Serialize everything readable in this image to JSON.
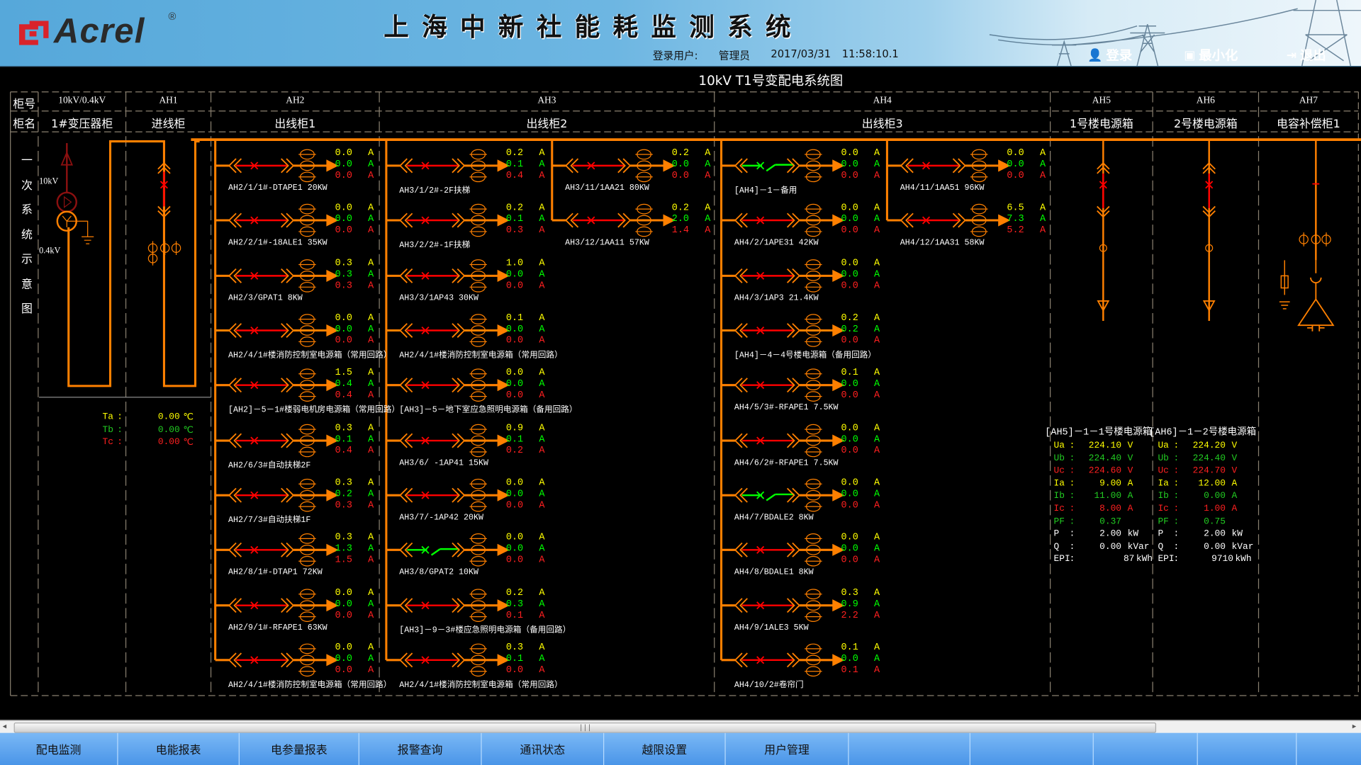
{
  "header": {
    "logo_text": "Acrel",
    "logo_reg": "®",
    "title": "上海中新社能耗监测系统",
    "user_label": "登录用户:",
    "user_name": "管理员",
    "date": "2017/03/31",
    "time": "11:58:10.1",
    "buttons": [
      {
        "label": "登录",
        "icon": "user-icon"
      },
      {
        "label": "最小化",
        "icon": "minimize-icon"
      },
      {
        "label": "退出",
        "icon": "exit-icon"
      }
    ],
    "colors": {
      "brand_red": "#d8232a",
      "header_blue": "#56a8da"
    }
  },
  "diagram": {
    "title": "10kV T1号变配电系统图",
    "row_header_no": "柜号",
    "row_header_name": "柜名",
    "side_title": [
      "一",
      "次",
      "系",
      "统",
      "示",
      "意",
      "图"
    ],
    "cabinets": [
      {
        "no": "10kV/0.4kV",
        "name": "1#变压器柜"
      },
      {
        "no": "AH1",
        "name": "进线柜"
      },
      {
        "no": "AH2",
        "name": "出线柜1"
      },
      {
        "no": "AH3",
        "name": "出线柜2"
      },
      {
        "no": "AH4",
        "name": "出线柜3"
      },
      {
        "no": "AH5",
        "name": "1号楼电源箱"
      },
      {
        "no": "AH6",
        "name": "2号楼电源箱"
      },
      {
        "no": "AH7",
        "name": "电容补偿柜1"
      }
    ],
    "transformer": {
      "hv": "10kV",
      "lv": "0.4kV"
    },
    "temperatures": [
      {
        "label": "Ta",
        "value": "0.00",
        "unit": "℃"
      },
      {
        "label": "Tb",
        "value": "0.00",
        "unit": "℃"
      },
      {
        "label": "Tc",
        "value": "0.00",
        "unit": "℃"
      }
    ],
    "unit": "A",
    "colors": {
      "bus": "#ff8000",
      "phase_a": "#ffff00",
      "phase_b": "#00ff00",
      "phase_c": "#ff0000",
      "breaker_closed": "#ff0000",
      "breaker_open": "#00ff00"
    },
    "ah2": [
      {
        "label": "AH2/1/1#-DTAPE1 20KW",
        "values": [
          "0.0",
          "0.0",
          "0.0"
        ],
        "state": "closed"
      },
      {
        "label": "AH2/2/1#-18ALE1 35KW",
        "values": [
          "0.0",
          "0.0",
          "0.0"
        ],
        "state": "closed"
      },
      {
        "label": "AH2/3/GPAT1 8KW",
        "values": [
          "0.3",
          "0.3",
          "0.3"
        ],
        "state": "closed"
      },
      {
        "label": "AH2/4/1#楼消防控制室电源箱（常用回路）",
        "values": [
          "0.0",
          "0.0",
          "0.0"
        ],
        "state": "closed"
      },
      {
        "label": "[AH2]－5－1#楼弱电机房电源箱（常用回路）",
        "values": [
          "1.5",
          "0.4",
          "0.4"
        ],
        "state": "closed"
      },
      {
        "label": "AH2/6/3#自动扶梯2F",
        "values": [
          "0.3",
          "0.1",
          "0.4"
        ],
        "state": "closed"
      },
      {
        "label": "AH2/7/3#自动扶梯1F",
        "values": [
          "0.3",
          "0.2",
          "0.3"
        ],
        "state": "closed"
      },
      {
        "label": "AH2/8/1#-DTAP1 72KW",
        "values": [
          "0.3",
          "1.3",
          "1.5"
        ],
        "state": "closed"
      },
      {
        "label": "AH2/9/1#-RFAPE1 63KW",
        "values": [
          "0.0",
          "0.0",
          "0.0"
        ],
        "state": "closed"
      },
      {
        "label": "AH2/4/1#楼消防控制室电源箱（常用回路）",
        "values": [
          "0.0",
          "0.0",
          "0.0"
        ],
        "state": "closed"
      }
    ],
    "ah3": [
      {
        "label": "AH3/1/2#-2F扶梯",
        "values": [
          "0.2",
          "0.1",
          "0.4"
        ],
        "state": "closed"
      },
      {
        "label": "AH3/2/2#-1F扶梯",
        "values": [
          "0.2",
          "0.1",
          "0.3"
        ],
        "state": "closed"
      },
      {
        "label": "AH3/3/1AP43 30KW",
        "values": [
          "1.0",
          "0.0",
          "0.0"
        ],
        "state": "closed"
      },
      {
        "label": "AH2/4/1#楼消防控制室电源箱（常用回路）",
        "values": [
          "0.1",
          "0.0",
          "0.0"
        ],
        "state": "closed"
      },
      {
        "label": "[AH3]－5－地下室应急照明电源箱（备用回路）",
        "values": [
          "0.0",
          "0.0",
          "0.0"
        ],
        "state": "closed"
      },
      {
        "label": "AH3/6/ -1AP41 15KW",
        "values": [
          "0.9",
          "0.1",
          "0.2"
        ],
        "state": "closed"
      },
      {
        "label": "AH3/7/-1AP42 20KW",
        "values": [
          "0.0",
          "0.0",
          "0.0"
        ],
        "state": "closed"
      },
      {
        "label": "AH3/8/GPAT2 10KW",
        "values": [
          "0.0",
          "0.0",
          "0.0"
        ],
        "state": "open"
      },
      {
        "label": "[AH3]－9－3#楼应急照明电源箱（备用回路）",
        "values": [
          "0.2",
          "0.3",
          "0.1"
        ],
        "state": "closed"
      },
      {
        "label": "AH2/4/1#楼消防控制室电源箱（常用回路）",
        "values": [
          "0.3",
          "0.1",
          "0.0"
        ],
        "state": "closed"
      }
    ],
    "ah3_sub": [
      {
        "label": "AH3/11/1AA21 80KW",
        "values": [
          "0.2",
          "0.0",
          "0.0"
        ],
        "state": "closed"
      },
      {
        "label": "AH3/12/1AA11 57KW",
        "values": [
          "0.2",
          "2.0",
          "1.4"
        ],
        "state": "closed"
      }
    ],
    "ah4": [
      {
        "label": "[AH4]－1－备用",
        "values": [
          "0.0",
          "0.0",
          "0.0"
        ],
        "state": "open"
      },
      {
        "label": "AH4/2/1APE31 42KW",
        "values": [
          "0.0",
          "0.0",
          "0.0"
        ],
        "state": "closed"
      },
      {
        "label": "AH4/3/1AP3 21.4KW",
        "values": [
          "0.0",
          "0.0",
          "0.0"
        ],
        "state": "closed"
      },
      {
        "label": "[AH4]－4－4号楼电源箱（备用回路）",
        "values": [
          "0.2",
          "0.2",
          "0.0"
        ],
        "state": "closed"
      },
      {
        "label": "AH4/5/3#-RFAPE1 7.5KW",
        "values": [
          "0.1",
          "0.0",
          "0.0"
        ],
        "state": "closed"
      },
      {
        "label": "AH4/6/2#-RFAPE1 7.5KW",
        "values": [
          "0.0",
          "0.0",
          "0.0"
        ],
        "state": "closed"
      },
      {
        "label": "AH4/7/BDALE2 8KW",
        "values": [
          "0.0",
          "0.0",
          "0.0"
        ],
        "state": "open"
      },
      {
        "label": "AH4/8/BDALE1 8KW",
        "values": [
          "0.0",
          "0.0",
          "0.0"
        ],
        "state": "closed"
      },
      {
        "label": "AH4/9/1ALE3 5KW",
        "values": [
          "0.3",
          "0.9",
          "2.2"
        ],
        "state": "closed"
      },
      {
        "label": "AH4/10/2#卷帘门",
        "values": [
          "0.1",
          "0.0",
          "0.1"
        ],
        "state": "closed"
      }
    ],
    "ah4_sub": [
      {
        "label": "AH4/11/1AA51 96KW",
        "values": [
          "0.0",
          "0.0",
          "0.0"
        ],
        "state": "closed"
      },
      {
        "label": "AH4/12/1AA31 58KW",
        "values": [
          "6.5",
          "7.3",
          "5.2"
        ],
        "state": "closed"
      }
    ],
    "meters": [
      {
        "title": "[AH5]－1－1号楼电源箱",
        "rows": [
          {
            "label": "Ua",
            "value": "224.10",
            "unit": "V"
          },
          {
            "label": "Ub",
            "value": "224.40",
            "unit": "V"
          },
          {
            "label": "Uc",
            "value": "224.60",
            "unit": "V"
          },
          {
            "label": "Ia",
            "value": "9.00",
            "unit": "A"
          },
          {
            "label": "Ib",
            "value": "11.00",
            "unit": "A"
          },
          {
            "label": "Ic",
            "value": "8.00",
            "unit": "A"
          },
          {
            "label": "PF",
            "value": "0.37",
            "unit": ""
          },
          {
            "label": "P",
            "value": "2.00",
            "unit": "kW"
          },
          {
            "label": "Q",
            "value": "0.00",
            "unit": "kVar"
          },
          {
            "label": "EPI",
            "value": "87",
            "unit": "kWh"
          }
        ]
      },
      {
        "title": "[AH6]－1－2号楼电源箱",
        "rows": [
          {
            "label": "Ua",
            "value": "224.20",
            "unit": "V"
          },
          {
            "label": "Ub",
            "value": "224.40",
            "unit": "V"
          },
          {
            "label": "Uc",
            "value": "224.70",
            "unit": "V"
          },
          {
            "label": "Ia",
            "value": "12.00",
            "unit": "A"
          },
          {
            "label": "Ib",
            "value": "0.00",
            "unit": "A"
          },
          {
            "label": "Ic",
            "value": "1.00",
            "unit": "A"
          },
          {
            "label": "PF",
            "value": "0.75",
            "unit": ""
          },
          {
            "label": "P",
            "value": "2.00",
            "unit": "kW"
          },
          {
            "label": "Q",
            "value": "0.00",
            "unit": "kVar"
          },
          {
            "label": "EPI",
            "value": "9710",
            "unit": "kWh"
          }
        ]
      }
    ]
  },
  "nav": [
    "配电监测",
    "电能报表",
    "电参量报表",
    "报警查询",
    "通讯状态",
    "越限设置",
    "用户管理",
    "",
    "",
    "",
    ""
  ]
}
